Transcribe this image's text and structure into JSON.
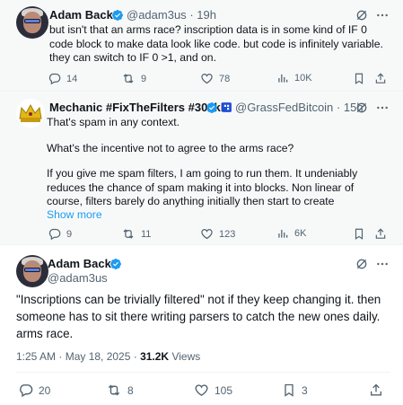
{
  "tweets": [
    {
      "name": "Adam Back",
      "handle": "@adam3us",
      "separator": "·",
      "time": "19h",
      "text": "but isn't that an arms race? inscription data is in some kind of IF 0 code block to make data look like code. but code is infinitely variable. they can switch to IF 0 >1, and on.",
      "replies": "14",
      "reposts": "9",
      "likes": "78",
      "views": "10K"
    },
    {
      "name": "Mechanic #FixTheFilters #300kb",
      "handle": "@GrassFedBitcoin",
      "separator": "·",
      "time": "15h",
      "para1": "That's spam in any context.",
      "para2": "What's the incentive not to agree to the arms race?",
      "para3": "If you give me spam filters, I am going to run them. It undeniably reduces the chance of spam making it into blocks. Non linear of course, filters barely do anything initially then start to create",
      "show_more": "Show more",
      "replies": "9",
      "reposts": "11",
      "likes": "123",
      "views": "6K"
    },
    {
      "name": "Adam Back",
      "handle": "@adam3us",
      "text": "\"Inscriptions can be trivially filtered\" not if they keep changing it. then someone has to sit there writing parsers to catch the new ones daily. arms race.",
      "time": "1:25 AM · May 18, 2025 · ",
      "views_count": "31.2K",
      "views_label": " Views",
      "replies": "20",
      "reposts": "8",
      "likes": "105",
      "bookmarks": "3"
    }
  ],
  "colors": {
    "text": "#0f1419",
    "muted": "#536471",
    "accent": "#1d9bf0",
    "verified": "#1d9bf0",
    "gold_badge": "#e2b719"
  },
  "icons": [
    "grok-icon",
    "more-icon",
    "reply-icon",
    "repost-icon",
    "like-icon",
    "views-icon",
    "bookmark-icon",
    "share-icon",
    "verified-badge-icon"
  ]
}
